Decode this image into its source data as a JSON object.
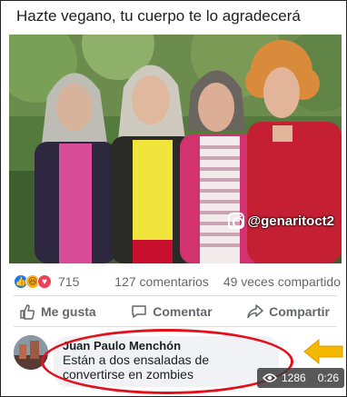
{
  "post": {
    "text": "Hazte vegano, tu cuerpo te lo agradecerá",
    "watermark": "@genaritoct2"
  },
  "stats": {
    "reactions_count": "715",
    "comments": "127 comentarios",
    "shares": "49 veces compartido",
    "reaction_icons": [
      "like-icon",
      "haha-icon",
      "love-icon"
    ]
  },
  "actions": {
    "like": "Me gusta",
    "comment": "Comentar",
    "share": "Compartir"
  },
  "comment": {
    "author": "Juan Paulo Menchón",
    "text": "Están a dos ensaladas de convertirse en zombies"
  },
  "video": {
    "views": "1286",
    "duration": "0:26"
  },
  "colors": {
    "highlight_oval": "#e3101c",
    "arrow": "#f5b800",
    "like_blue": "#1877f2"
  }
}
